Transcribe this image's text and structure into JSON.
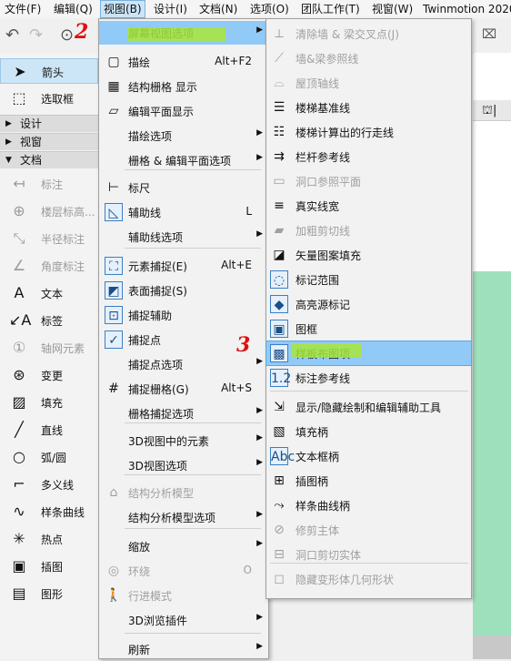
{
  "menubar": [
    "文件(F)",
    "编辑(Q)",
    "视图(B)",
    "设计(I)",
    "文档(N)",
    "选项(O)",
    "团队工作(T)",
    "视窗(W)",
    "Twinmotion 2020"
  ],
  "left_panel": {
    "items": [
      {
        "label": "箭头",
        "icon": "arrow-icon"
      },
      {
        "label": "选取框",
        "icon": "marquee-icon"
      }
    ],
    "sections": [
      "设计",
      "视窗",
      "文档"
    ],
    "tools": [
      {
        "label": "标注",
        "icon": "dimension-icon",
        "disabled": true
      },
      {
        "label": "楼层标高...",
        "icon": "level-dimension-icon",
        "disabled": true
      },
      {
        "label": "半径标注",
        "icon": "radial-dimension-icon",
        "disabled": true
      },
      {
        "label": "角度标注",
        "icon": "angle-dimension-icon",
        "disabled": true
      },
      {
        "label": "文本",
        "icon": "text-icon",
        "disabled": false
      },
      {
        "label": "标签",
        "icon": "label-icon",
        "disabled": false
      },
      {
        "label": "轴网元素",
        "icon": "grid-element-icon",
        "disabled": true
      },
      {
        "label": "变更",
        "icon": "change-icon",
        "disabled": false
      },
      {
        "label": "填充",
        "icon": "fill-icon",
        "disabled": false
      },
      {
        "label": "直线",
        "icon": "line-icon",
        "disabled": false
      },
      {
        "label": "弧/圆",
        "icon": "arc-icon",
        "disabled": false
      },
      {
        "label": "多义线",
        "icon": "polyline-icon",
        "disabled": false
      },
      {
        "label": "样条曲线",
        "icon": "spline-icon",
        "disabled": false
      },
      {
        "label": "热点",
        "icon": "hotspot-icon",
        "disabled": false
      },
      {
        "label": "插图",
        "icon": "figure-icon",
        "disabled": false
      },
      {
        "label": "图形",
        "icon": "drawing-icon",
        "disabled": false
      }
    ]
  },
  "menu1": [
    {
      "label": "屏幕视图选项",
      "sub": true,
      "hl": true,
      "icon": ""
    },
    {
      "label": "描绘",
      "shortcut": "Alt+F2",
      "icon": "trace-icon"
    },
    {
      "label": "结构栅格 显示",
      "icon": "structural-grid-icon"
    },
    {
      "label": "编辑平面显示",
      "icon": "edit-plane-icon"
    },
    {
      "label": "描绘选项",
      "sub": true
    },
    {
      "label": "栅格 & 编辑平面选项",
      "sub": true
    },
    {
      "label": "标尺",
      "icon": "ruler-icon"
    },
    {
      "label": "辅助线",
      "shortcut": "L",
      "icon": "guide-line-icon"
    },
    {
      "label": "辅助线选项",
      "sub": true
    },
    {
      "label": "元素捕捉(E)",
      "shortcut": "Alt+E",
      "icon": "element-snap-icon"
    },
    {
      "label": "表面捕捉(S)",
      "icon": "surface-snap-icon"
    },
    {
      "label": "捕捉辅助",
      "icon": "snap-guide-icon"
    },
    {
      "label": "捕捉点",
      "icon": "snap-point-icon"
    },
    {
      "label": "捕捉点选项",
      "sub": true
    },
    {
      "label": "捕捉栅格(G)",
      "shortcut": "Alt+S",
      "icon": "snap-grid-icon"
    },
    {
      "label": "栅格捕捉选项",
      "sub": true
    },
    {
      "label": "3D视图中的元素",
      "sub": true
    },
    {
      "label": "3D视图选项",
      "sub": true
    },
    {
      "label": "结构分析模型",
      "disabled": true,
      "icon": "structural-model-icon"
    },
    {
      "label": "结构分析模型选项",
      "sub": true
    },
    {
      "label": "缩放",
      "sub": true
    },
    {
      "label": "环绕",
      "shortcut": "O",
      "disabled": true,
      "icon": "orbit-icon"
    },
    {
      "label": "行进模式",
      "disabled": true,
      "icon": "walk-icon"
    },
    {
      "label": "3D浏览插件",
      "sub": true
    },
    {
      "label": "刷新",
      "sub": true
    }
  ],
  "menu2": [
    {
      "label": "清除墙 & 梁交叉点(J)",
      "disabled": true,
      "icon": "clean-intersections-icon"
    },
    {
      "label": "墙&梁参照线",
      "disabled": true,
      "icon": "reference-line-icon"
    },
    {
      "label": "屋顶轴线",
      "disabled": true,
      "icon": "roof-axis-icon"
    },
    {
      "label": "楼梯基准线",
      "icon": "stair-baseline-icon"
    },
    {
      "label": "楼梯计算出的行走线",
      "icon": "stair-walkline-icon"
    },
    {
      "label": "栏杆参考线",
      "icon": "railing-reference-icon"
    },
    {
      "label": "洞口参照平面",
      "disabled": true,
      "icon": "opening-plane-icon"
    },
    {
      "label": "真实线宽",
      "icon": "true-line-weight-icon"
    },
    {
      "label": "加粗剪切线",
      "disabled": true,
      "icon": "bold-cut-line-icon"
    },
    {
      "label": "矢量图案填充",
      "icon": "vector-hatch-icon"
    },
    {
      "label": "标记范围",
      "icon": "marker-range-icon"
    },
    {
      "label": "高亮源标记",
      "icon": "highlight-source-icon"
    },
    {
      "label": "图框",
      "icon": "drawing-frame-icon"
    },
    {
      "label": "样板布图项",
      "hl": true,
      "icon": "master-layout-icon"
    },
    {
      "label": "标注参考线",
      "icon": "dimension-reference-icon"
    },
    {
      "label": "显示/隐藏绘制和编辑辅助工具",
      "icon": "show-hide-tools-icon"
    },
    {
      "label": "填充柄",
      "icon": "fill-handle-icon"
    },
    {
      "label": "文本框柄",
      "icon": "text-handle-icon"
    },
    {
      "label": "插图柄",
      "icon": "figure-handle-icon"
    },
    {
      "label": "样条曲线柄",
      "icon": "spline-handle-icon"
    },
    {
      "label": "修剪主体",
      "disabled": true,
      "icon": "trim-body-icon"
    },
    {
      "label": "洞口剪切实体",
      "disabled": true,
      "icon": "opening-cut-icon"
    },
    {
      "label": "隐藏变形体几何形状",
      "disabled": true,
      "icon": "hide-morph-icon"
    }
  ],
  "annotations": [
    "2",
    "3"
  ],
  "colors": {
    "highlight": "#91c9f7",
    "marker": "#a8e63a",
    "annotation": "#e01010",
    "canvas_green": "#9ee0bc"
  }
}
